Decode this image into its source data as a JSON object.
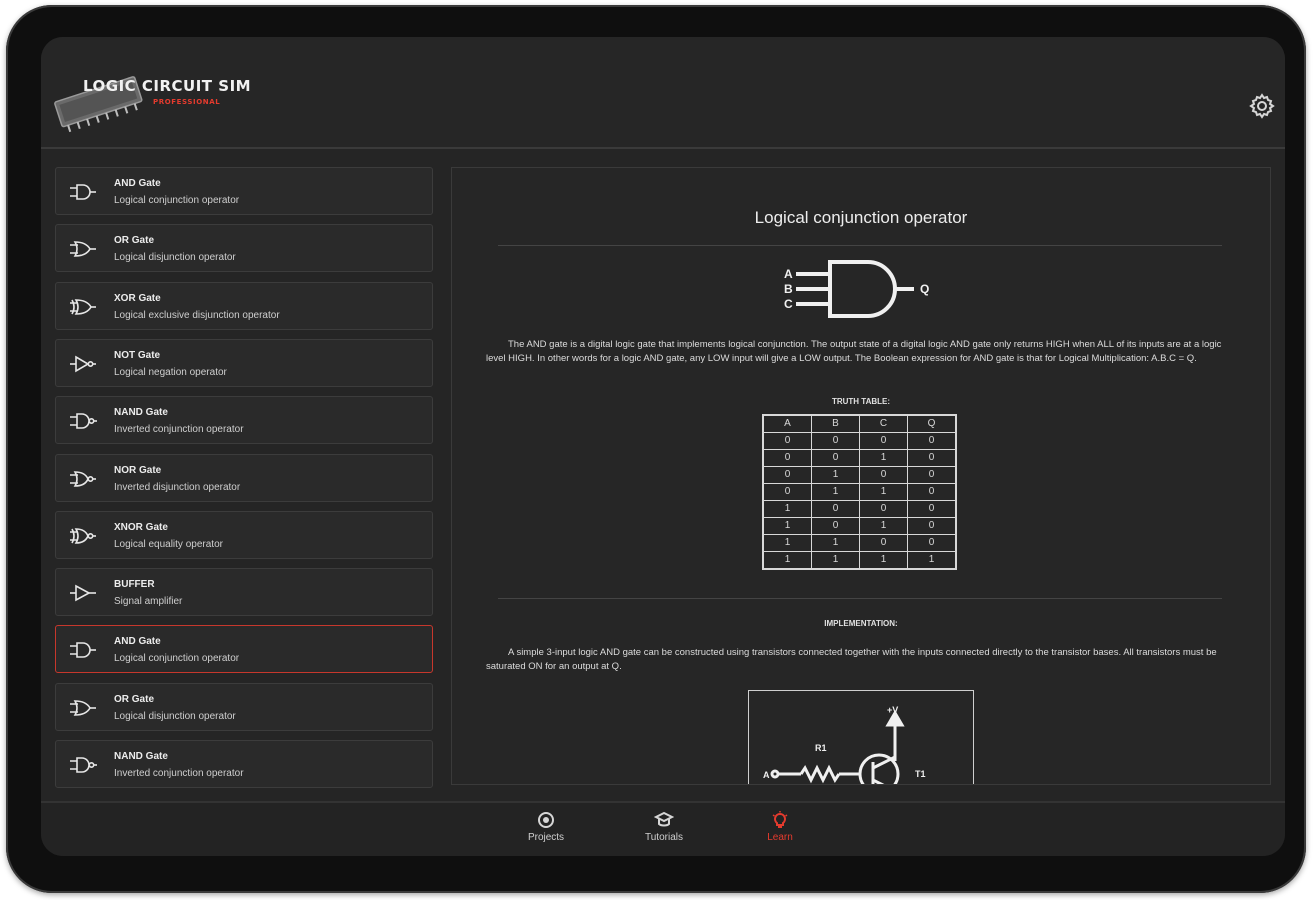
{
  "app": {
    "logo_title": "LOGIC CIRCUIT SIM",
    "logo_sub": "PROFESSIONAL",
    "accent": "#e53b2e"
  },
  "list": {
    "items": [
      {
        "title": "AND Gate",
        "subtitle": "Logical conjunction operator",
        "icon": "and-gate-icon"
      },
      {
        "title": "OR Gate",
        "subtitle": "Logical disjunction operator",
        "icon": "or-gate-icon"
      },
      {
        "title": "XOR Gate",
        "subtitle": "Logical exclusive disjunction operator",
        "icon": "xor-gate-icon"
      },
      {
        "title": "NOT Gate",
        "subtitle": "Logical negation operator",
        "icon": "not-gate-icon"
      },
      {
        "title": "NAND Gate",
        "subtitle": "Inverted conjunction operator",
        "icon": "nand-gate-icon"
      },
      {
        "title": "NOR Gate",
        "subtitle": "Inverted disjunction operator",
        "icon": "nor-gate-icon"
      },
      {
        "title": "XNOR Gate",
        "subtitle": "Logical equality operator",
        "icon": "xnor-gate-icon"
      },
      {
        "title": "BUFFER",
        "subtitle": "Signal amplifier",
        "icon": "buffer-gate-icon"
      },
      {
        "title": "AND Gate",
        "subtitle": "Logical conjunction operator",
        "icon": "and-gate-icon",
        "selected": true
      },
      {
        "title": "OR Gate",
        "subtitle": "Logical disjunction operator",
        "icon": "or-gate-icon"
      },
      {
        "title": "NAND Gate",
        "subtitle": "Inverted conjunction operator",
        "icon": "nand-gate-icon"
      }
    ]
  },
  "detail": {
    "title": "Logical conjunction operator",
    "symbol": {
      "in_a": "A",
      "in_b": "B",
      "in_c": "C",
      "out_q": "Q"
    },
    "description": "The AND gate is a digital logic gate that implements logical conjunction. The output state of a digital logic AND gate only returns HIGH when ALL of its inputs are at a logic level HIGH. In other words for a logic AND gate, any LOW input will give a LOW output. The Boolean expression for AND gate is that for Logical Multiplication: A.B.C = Q.",
    "truth_table_caption": "TRUTH TABLE:",
    "truth_table": {
      "headers": [
        "A",
        "B",
        "C",
        "Q"
      ],
      "rows": [
        [
          "0",
          "0",
          "0",
          "0"
        ],
        [
          "0",
          "0",
          "1",
          "0"
        ],
        [
          "0",
          "1",
          "0",
          "0"
        ],
        [
          "0",
          "1",
          "1",
          "0"
        ],
        [
          "1",
          "0",
          "0",
          "0"
        ],
        [
          "1",
          "0",
          "1",
          "0"
        ],
        [
          "1",
          "1",
          "0",
          "0"
        ],
        [
          "1",
          "1",
          "1",
          "1"
        ]
      ]
    },
    "impl_caption": "IMPLEMENTATION:",
    "impl_text": "A simple 3-input logic AND gate can be constructed using transistors connected together with the inputs connected directly to the transistor bases. All transistors must be saturated ON for an output at Q.",
    "circuit": {
      "vplus": "+V",
      "r1": "R1",
      "a": "A",
      "t1": "T1"
    }
  },
  "nav": {
    "items": [
      {
        "label": "Projects",
        "icon": "projects-icon"
      },
      {
        "label": "Tutorials",
        "icon": "tutorials-icon"
      },
      {
        "label": "Learn",
        "icon": "learn-bulb-icon",
        "active": true
      }
    ]
  }
}
